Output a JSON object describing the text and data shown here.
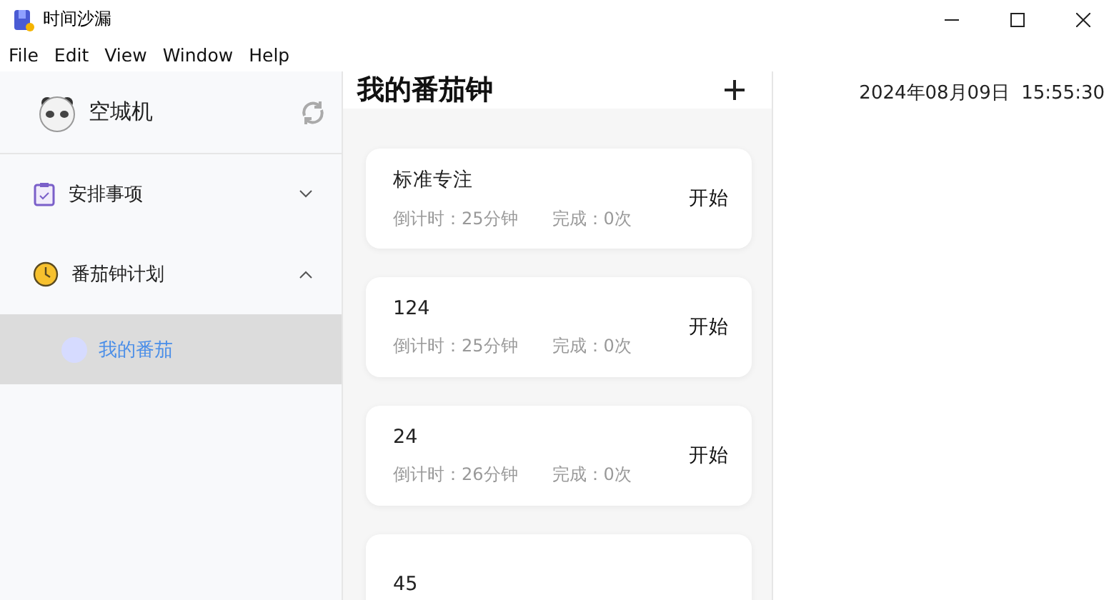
{
  "window": {
    "title": "时间沙漏"
  },
  "menu": [
    "File",
    "Edit",
    "View",
    "Window",
    "Help"
  ],
  "sidebar": {
    "user": {
      "name": "空城机"
    },
    "items": [
      {
        "label": "安排事项",
        "expanded": false
      },
      {
        "label": "番茄钟计划",
        "expanded": true,
        "children": [
          {
            "label": "我的番茄",
            "selected": true
          }
        ]
      }
    ]
  },
  "main": {
    "title": "我的番茄钟",
    "timers": [
      {
        "name": "标准专注",
        "countdown": "倒计时：25分钟",
        "completed": "完成：0次",
        "action": "开始"
      },
      {
        "name": "124",
        "countdown": "倒计时：25分钟",
        "completed": "完成：0次",
        "action": "开始"
      },
      {
        "name": "24",
        "countdown": "倒计时：26分钟",
        "completed": "完成：0次",
        "action": "开始"
      },
      {
        "name": "45"
      }
    ]
  },
  "clock": "2024年08月09日  15:55:30"
}
